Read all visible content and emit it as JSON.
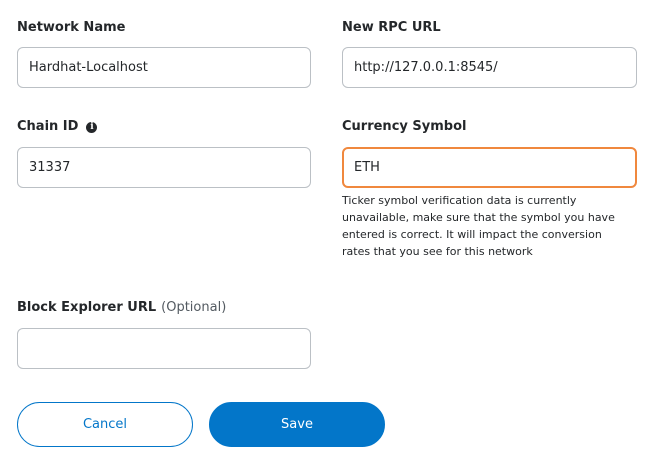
{
  "form": {
    "network_name": {
      "label": "Network Name",
      "value": "Hardhat-Localhost"
    },
    "rpc_url": {
      "label": "New RPC URL",
      "value": "http://127.0.0.1:8545/"
    },
    "chain_id": {
      "label": "Chain ID",
      "info_icon": "i",
      "value": "31337"
    },
    "currency_symbol": {
      "label": "Currency Symbol",
      "value": "ETH",
      "warning": "Ticker symbol verification data is currently unavailable, make sure that the symbol you have entered is correct. It will impact the conversion rates that you see for this network"
    },
    "block_explorer": {
      "label": "Block Explorer URL",
      "optional_label": "(Optional)",
      "value": ""
    }
  },
  "buttons": {
    "cancel": "Cancel",
    "save": "Save"
  },
  "colors": {
    "primary": "#0376c9",
    "warning_border": "#f0883e",
    "input_border": "#bbc0c5",
    "text": "#24272a"
  }
}
